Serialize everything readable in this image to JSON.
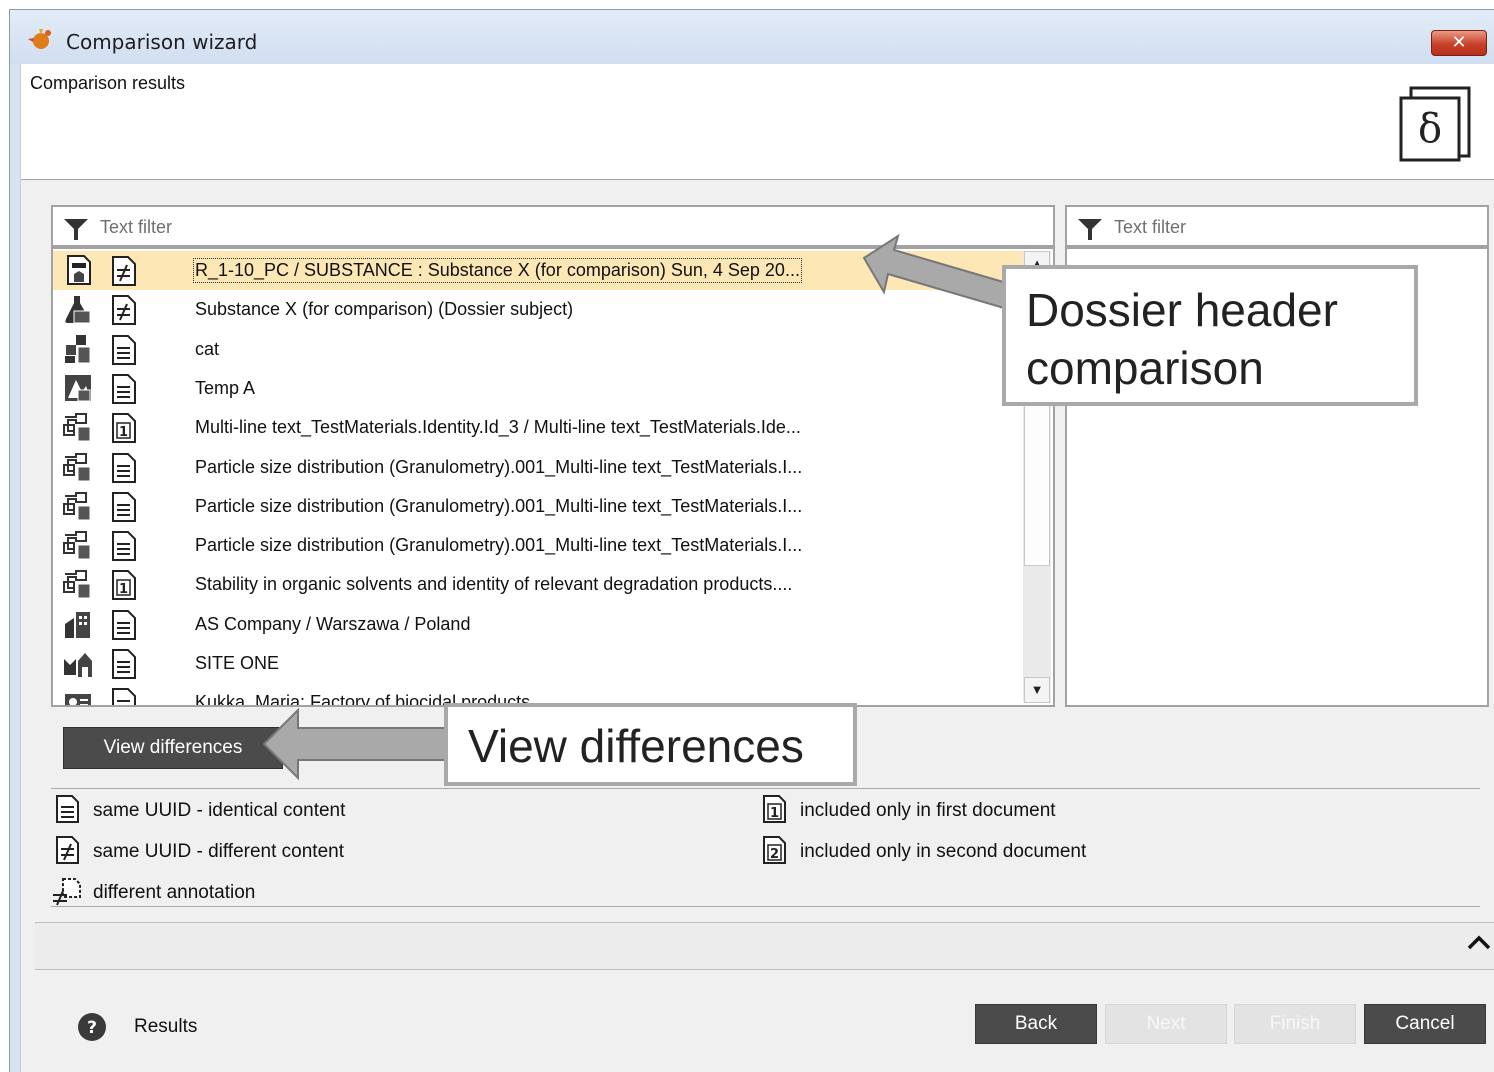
{
  "window": {
    "title": "Comparison wizard",
    "close_label": "✕"
  },
  "header": {
    "subtitle": "Comparison results"
  },
  "left_filter": {
    "placeholder": "Text filter"
  },
  "right_filter": {
    "placeholder": "Text filter"
  },
  "tree": {
    "rows": [
      {
        "label": "R_1-10_PC / SUBSTANCE : Substance X (for comparison) Sun, 4 Sep 20...",
        "type_icon": "dossier-icon",
        "status_icon": "different-content-icon",
        "selected": true
      },
      {
        "label": "Substance X (for comparison) (Dossier subject)",
        "type_icon": "substance-icon",
        "status_icon": "different-content-icon",
        "selected": false
      },
      {
        "label": "cat",
        "type_icon": "reference-substance-icon",
        "status_icon": "identical-content-icon",
        "selected": false
      },
      {
        "label": "Temp A",
        "type_icon": "template-icon",
        "status_icon": "identical-content-icon",
        "selected": false
      },
      {
        "label": "Multi-line text_TestMaterials.Identity.Id_3 / Multi-line text_TestMaterials.Ide...",
        "type_icon": "test-material-icon",
        "status_icon": "only-first-icon",
        "selected": false
      },
      {
        "label": "Particle size distribution (Granulometry).001_Multi-line text_TestMaterials.I...",
        "type_icon": "test-material-icon",
        "status_icon": "identical-content-icon",
        "selected": false
      },
      {
        "label": "Particle size distribution (Granulometry).001_Multi-line text_TestMaterials.I...",
        "type_icon": "test-material-icon",
        "status_icon": "identical-content-icon",
        "selected": false
      },
      {
        "label": "Particle size distribution (Granulometry).001_Multi-line text_TestMaterials.I...",
        "type_icon": "test-material-icon",
        "status_icon": "identical-content-icon",
        "selected": false
      },
      {
        "label": "Stability in organic solvents and identity of relevant degradation products....",
        "type_icon": "test-material-icon",
        "status_icon": "only-first-icon",
        "selected": false
      },
      {
        "label": "AS Company / Warszawa / Poland",
        "type_icon": "legal-entity-icon",
        "status_icon": "identical-content-icon",
        "selected": false
      },
      {
        "label": "SITE ONE",
        "type_icon": "site-icon",
        "status_icon": "identical-content-icon",
        "selected": false
      },
      {
        "label": "Kukka, Maria: Factory of biocidal products",
        "type_icon": "contact-icon",
        "status_icon": "identical-content-icon",
        "selected": false
      }
    ]
  },
  "view_differences_button": "View differences",
  "legend": {
    "identical": "same UUID - identical content",
    "different": "same UUID - different content",
    "annotation": "different annotation",
    "only_first": "included only in first document",
    "only_second": "included only in second document"
  },
  "footer": {
    "help_label": "Results",
    "back": "Back",
    "next": "Next",
    "finish": "Finish",
    "cancel": "Cancel"
  },
  "callouts": {
    "dossier_line1": "Dossier header",
    "dossier_line2": "comparison",
    "view_diff": "View differences"
  }
}
